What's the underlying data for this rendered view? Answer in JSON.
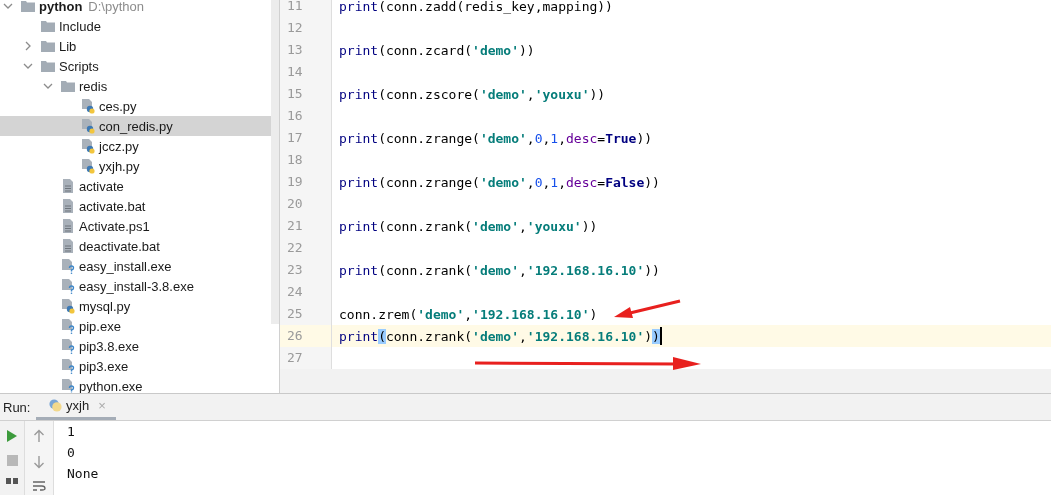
{
  "project_tree": {
    "items": [
      {
        "label": "python",
        "hint": "D:\\python",
        "kind": "folder",
        "expanded": true,
        "selected": false,
        "children": [
          {
            "label": "Include",
            "kind": "folder",
            "selected": false
          },
          {
            "label": "Lib",
            "kind": "folder",
            "expanded": false,
            "selected": false
          },
          {
            "label": "Scripts",
            "kind": "folder",
            "expanded": true,
            "selected": false,
            "children": [
              {
                "label": "redis",
                "kind": "folder",
                "expanded": true,
                "selected": false,
                "children": [
                  {
                    "label": "ces.py",
                    "kind": "python",
                    "selected": false
                  },
                  {
                    "label": "con_redis.py",
                    "kind": "python",
                    "selected": true
                  },
                  {
                    "label": "jccz.py",
                    "kind": "python",
                    "selected": false
                  },
                  {
                    "label": "yxjh.py",
                    "kind": "python",
                    "selected": false
                  }
                ]
              },
              {
                "label": "activate",
                "kind": "text",
                "selected": false
              },
              {
                "label": "activate.bat",
                "kind": "text",
                "selected": false
              },
              {
                "label": "Activate.ps1",
                "kind": "text",
                "selected": false
              },
              {
                "label": "deactivate.bat",
                "kind": "text",
                "selected": false
              },
              {
                "label": "easy_install.exe",
                "kind": "unknown",
                "selected": false
              },
              {
                "label": "easy_install-3.8.exe",
                "kind": "unknown",
                "selected": false
              },
              {
                "label": "mysql.py",
                "kind": "python",
                "selected": false
              },
              {
                "label": "pip.exe",
                "kind": "unknown",
                "selected": false
              },
              {
                "label": "pip3.8.exe",
                "kind": "unknown",
                "selected": false
              },
              {
                "label": "pip3.exe",
                "kind": "unknown",
                "selected": false
              },
              {
                "label": "python.exe",
                "kind": "unknown",
                "selected": false
              }
            ]
          }
        ]
      }
    ]
  },
  "editor": {
    "lines": [
      {
        "number": "11",
        "current": false,
        "tokens": [
          {
            "kind": "builtin",
            "text": "print"
          },
          {
            "kind": "plain",
            "text": "(conn.zadd(redis_key,mapping))"
          }
        ]
      },
      {
        "number": "12",
        "current": false
      },
      {
        "number": "13",
        "current": false,
        "tokens": [
          {
            "kind": "builtin",
            "text": "print"
          },
          {
            "kind": "plain",
            "text": "(conn.zcard("
          },
          {
            "kind": "string",
            "text": "'demo'"
          },
          {
            "kind": "plain",
            "text": "))"
          }
        ]
      },
      {
        "number": "14",
        "current": false
      },
      {
        "number": "15",
        "current": false,
        "tokens": [
          {
            "kind": "builtin",
            "text": "print"
          },
          {
            "kind": "plain",
            "text": "(conn.zscore("
          },
          {
            "kind": "string",
            "text": "'demo'"
          },
          {
            "kind": "plain",
            "text": ","
          },
          {
            "kind": "string",
            "text": "'youxu'"
          },
          {
            "kind": "plain",
            "text": "))"
          }
        ]
      },
      {
        "number": "16",
        "current": false
      },
      {
        "number": "17",
        "current": false,
        "tokens": [
          {
            "kind": "builtin",
            "text": "print"
          },
          {
            "kind": "plain",
            "text": "(conn.zrange("
          },
          {
            "kind": "string",
            "text": "'demo'"
          },
          {
            "kind": "plain",
            "text": ","
          },
          {
            "kind": "number",
            "text": "0"
          },
          {
            "kind": "plain",
            "text": ","
          },
          {
            "kind": "number",
            "text": "1"
          },
          {
            "kind": "plain",
            "text": ","
          },
          {
            "kind": "param",
            "text": "desc"
          },
          {
            "kind": "plain",
            "text": "="
          },
          {
            "kind": "constant",
            "text": "True"
          },
          {
            "kind": "plain",
            "text": "))"
          }
        ]
      },
      {
        "number": "18",
        "current": false
      },
      {
        "number": "19",
        "current": false,
        "tokens": [
          {
            "kind": "builtin",
            "text": "print"
          },
          {
            "kind": "plain",
            "text": "(conn.zrange("
          },
          {
            "kind": "string",
            "text": "'demo'"
          },
          {
            "kind": "plain",
            "text": ","
          },
          {
            "kind": "number",
            "text": "0"
          },
          {
            "kind": "plain",
            "text": ","
          },
          {
            "kind": "number",
            "text": "1"
          },
          {
            "kind": "plain",
            "text": ","
          },
          {
            "kind": "param",
            "text": "desc"
          },
          {
            "kind": "plain",
            "text": "="
          },
          {
            "kind": "constant",
            "text": "False"
          },
          {
            "kind": "plain",
            "text": "))"
          }
        ]
      },
      {
        "number": "20",
        "current": false
      },
      {
        "number": "21",
        "current": false,
        "tokens": [
          {
            "kind": "builtin",
            "text": "print"
          },
          {
            "kind": "plain",
            "text": "(conn.zrank("
          },
          {
            "kind": "string",
            "text": "'demo'"
          },
          {
            "kind": "plain",
            "text": ","
          },
          {
            "kind": "string",
            "text": "'youxu'"
          },
          {
            "kind": "plain",
            "text": "))"
          }
        ]
      },
      {
        "number": "22",
        "current": false
      },
      {
        "number": "23",
        "current": false,
        "tokens": [
          {
            "kind": "builtin",
            "text": "print"
          },
          {
            "kind": "plain",
            "text": "(conn.zrank("
          },
          {
            "kind": "string",
            "text": "'demo'"
          },
          {
            "kind": "plain",
            "text": ","
          },
          {
            "kind": "string",
            "text": "'192.168.16.10'"
          },
          {
            "kind": "plain",
            "text": "))"
          }
        ]
      },
      {
        "number": "24",
        "current": false
      },
      {
        "number": "25",
        "current": false,
        "tokens": [
          {
            "kind": "plain",
            "text": "conn.zrem("
          },
          {
            "kind": "string",
            "text": "'demo'"
          },
          {
            "kind": "plain",
            "text": ","
          },
          {
            "kind": "string",
            "text": "'192.168.16.10'"
          },
          {
            "kind": "plain",
            "text": ")"
          }
        ]
      },
      {
        "number": "26",
        "current": true,
        "tokens": [
          {
            "kind": "builtin",
            "text": "print"
          },
          {
            "kind": "brace-match",
            "text": "("
          },
          {
            "kind": "plain",
            "text": "conn.zrank("
          },
          {
            "kind": "string",
            "text": "'demo'"
          },
          {
            "kind": "plain",
            "text": ","
          },
          {
            "kind": "string",
            "text": "'192.168.16.10'"
          },
          {
            "kind": "plain",
            "text": ")"
          },
          {
            "kind": "brace-match",
            "text": ")"
          }
        ]
      },
      {
        "number": "27",
        "current": false
      }
    ]
  },
  "run_panel": {
    "label": "Run:",
    "tabs": [
      {
        "label": "yxjh",
        "close": "×",
        "selected": true
      }
    ],
    "output": [
      "1",
      "0",
      "None"
    ]
  }
}
